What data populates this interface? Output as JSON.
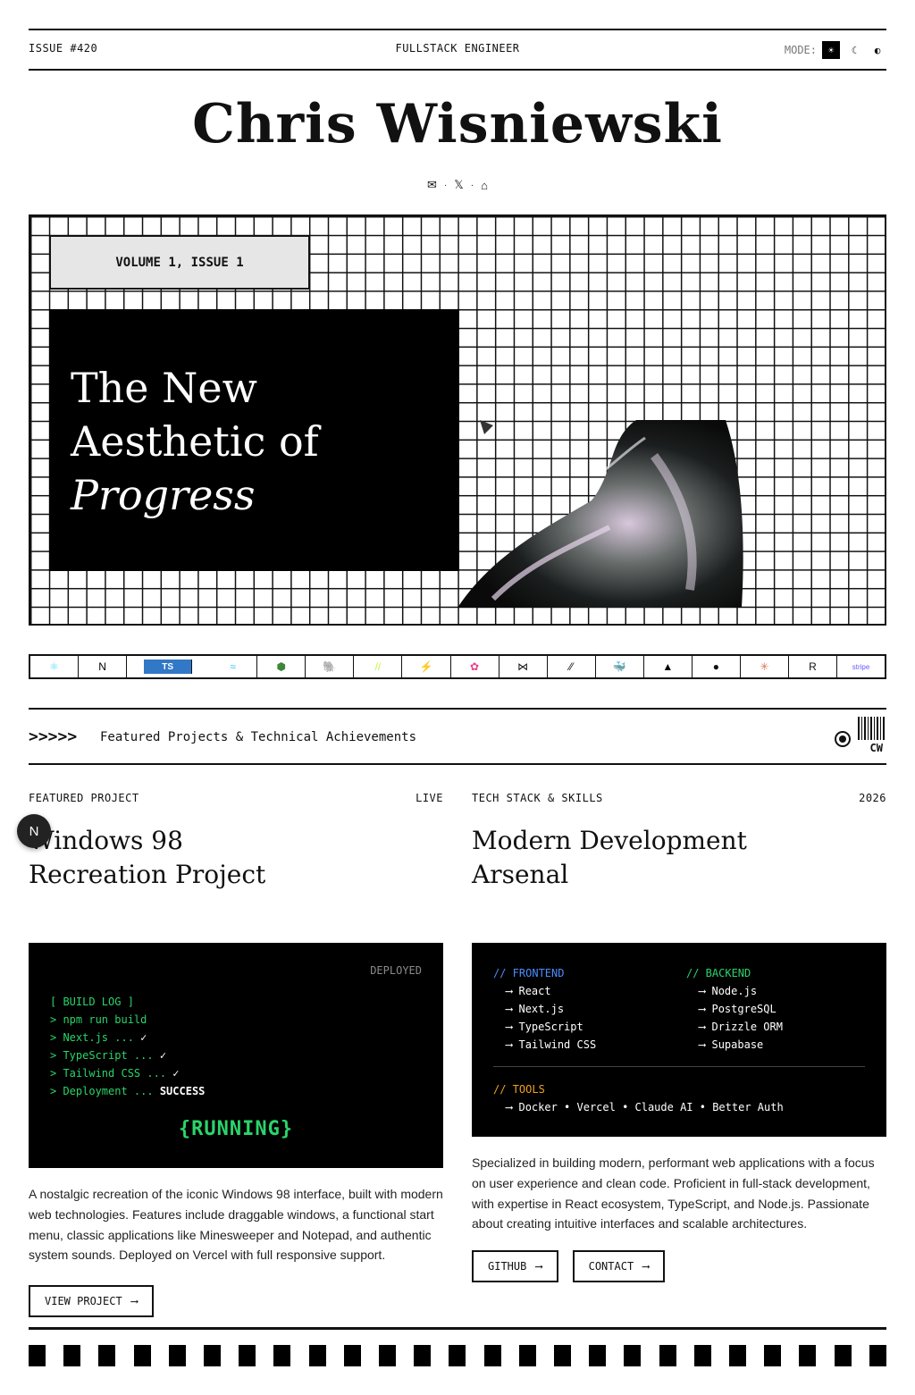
{
  "topbar": {
    "issue": "ISSUE #420",
    "role": "FULLSTACK ENGINEER",
    "mode_label": "MODE:",
    "mode_options": [
      "☀",
      "☾",
      "◐"
    ]
  },
  "masthead": {
    "name": "Chris Wisniewski",
    "socials": [
      "✉",
      "𝕏",
      "⌂"
    ],
    "separator": "·"
  },
  "hero": {
    "volume": "VOLUME 1, ISSUE 1",
    "headline_line1": "The New",
    "headline_line2": "Aesthetic of",
    "headline_line3": "Progress"
  },
  "tech_logos": [
    {
      "icon": "react-icon",
      "glyph": "⚛",
      "color": "#61dafb"
    },
    {
      "icon": "nextjs-icon",
      "glyph": "N",
      "color": "#000000"
    },
    {
      "icon": "typescript-icon",
      "glyph": "TS",
      "color": "#3178c6"
    },
    {
      "icon": "tailwind-icon",
      "glyph": "≈",
      "color": "#38bdf8"
    },
    {
      "icon": "nodejs-icon",
      "glyph": "⬢",
      "color": "#3c873a"
    },
    {
      "icon": "postgresql-icon",
      "glyph": "🐘",
      "color": "#336791"
    },
    {
      "icon": "drizzle-icon",
      "glyph": "//",
      "color": "#c5f74f"
    },
    {
      "icon": "supabase-icon",
      "glyph": "⚡",
      "color": "#3ecf8e"
    },
    {
      "icon": "flower-icon",
      "glyph": "✿",
      "color": "#e8408a"
    },
    {
      "icon": "kotlin-icon",
      "glyph": "⋈",
      "color": "#111111"
    },
    {
      "icon": "slash-icon",
      "glyph": "⁄⁄",
      "color": "#111111"
    },
    {
      "icon": "docker-icon",
      "glyph": "🐳",
      "color": "#2496ed"
    },
    {
      "icon": "vercel-icon",
      "glyph": "▲",
      "color": "#000000"
    },
    {
      "icon": "github-icon",
      "glyph": "●",
      "color": "#111111"
    },
    {
      "icon": "claude-icon",
      "glyph": "✳",
      "color": "#d97757"
    },
    {
      "icon": "resend-icon",
      "glyph": "R",
      "color": "#111111"
    },
    {
      "icon": "stripe-icon",
      "glyph": "stripe",
      "color": "#635bff"
    }
  ],
  "banner": {
    "arrows": ">>>>>",
    "caption": "Featured Projects & Technical Achievements",
    "barcode_label": "CW"
  },
  "project": {
    "kicker": "FEATURED PROJECT",
    "status": "LIVE",
    "title_line1": "Windows 98",
    "title_line2": "Recreation Project",
    "deployed": "DEPLOYED",
    "log": [
      "[ BUILD LOG ]",
      "> npm run build",
      "> Next.js ...",
      "> TypeScript ...",
      "> Tailwind CSS ...",
      "> Deployment ..."
    ],
    "check": "✓",
    "success": "SUCCESS",
    "running": "{RUNNING}",
    "description": "A nostalgic recreation of the iconic Windows 98 interface, built with modern web technologies. Features include draggable windows, a functional start menu, classic applications like Minesweeper and Notepad, and authentic system sounds. Deployed on Vercel with full responsive support.",
    "button": "VIEW PROJECT",
    "arrow": "⟶"
  },
  "skills": {
    "kicker": "TECH STACK & SKILLS",
    "year": "2026",
    "title_line1": "Modern Development",
    "title_line2": "Arsenal",
    "frontend_heading": "// FRONTEND",
    "frontend": [
      "React",
      "Next.js",
      "TypeScript",
      "Tailwind CSS"
    ],
    "backend_heading": "// BACKEND",
    "backend": [
      "Node.js",
      "PostgreSQL",
      "Drizzle ORM",
      "Supabase"
    ],
    "tools_heading": "// TOOLS",
    "tools": "Docker • Vercel • Claude AI • Better Auth",
    "bullet_arrow": "⟶",
    "description": "Specialized in building modern, performant web applications with a focus on user experience and clean code. Proficient in full-stack development, with expertise in React ecosystem, TypeScript, and Node.js. Passionate about creating intuitive interfaces and scalable architectures.",
    "github_button": "GITHUB",
    "contact_button": "CONTACT",
    "arrow": "⟶"
  },
  "avatar": {
    "glyph": "N"
  }
}
